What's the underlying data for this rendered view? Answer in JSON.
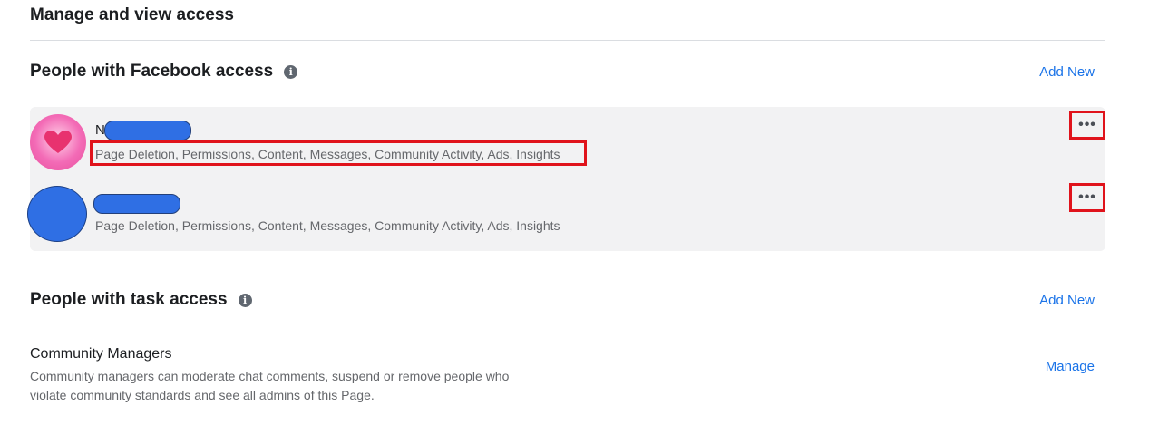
{
  "page": {
    "heading": "Manage and view access"
  },
  "facebook_access": {
    "title": "People with Facebook access",
    "info_icon": "info-icon",
    "add_new_label": "Add New",
    "people": [
      {
        "name_visible": "N",
        "name_redacted": true,
        "avatar": "pink-heart-avatar",
        "permissions": "Page Deletion, Permissions, Content, Messages, Community Activity, Ads, Insights",
        "more_icon": "•••"
      },
      {
        "name_visible": "",
        "name_redacted": true,
        "avatar": "blue-redacted-avatar",
        "permissions": "Page Deletion, Permissions, Content, Messages, Community Activity, Ads, Insights",
        "more_icon": "•••"
      }
    ]
  },
  "task_access": {
    "title": "People with task access",
    "info_icon": "info-icon",
    "add_new_label": "Add New",
    "community_managers": {
      "title": "Community Managers",
      "description_line1": "Community managers can moderate chat comments, suspend or remove people who",
      "description_line2": "violate community standards and see all admins of this Page.",
      "manage_label": "Manage"
    }
  },
  "colors": {
    "link": "#1a73e8",
    "highlight_box": "#e0131b",
    "redaction": "#2f6fe4",
    "row_background": "#f2f2f3"
  }
}
